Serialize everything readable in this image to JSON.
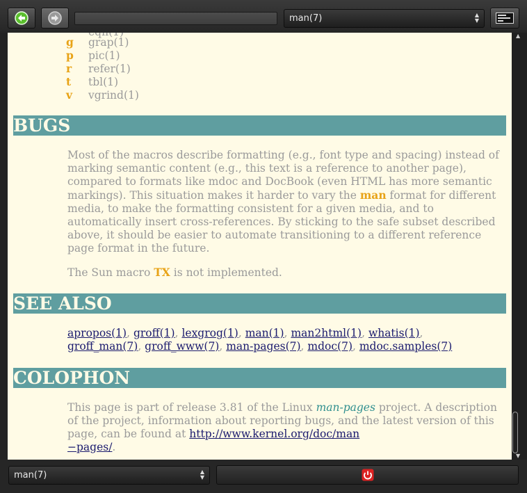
{
  "toolbar": {
    "back_icon": "arrow-left-icon",
    "forward_icon": "arrow-right-icon",
    "page_select": "man(7)",
    "terminal_icon": "terminal-icon"
  },
  "index_entries": [
    {
      "letter": "g",
      "ref": "grap(1)"
    },
    {
      "letter": "p",
      "ref": "pic(1)"
    },
    {
      "letter": "r",
      "ref": "refer(1)"
    },
    {
      "letter": "t",
      "ref": "tbl(1)"
    },
    {
      "letter": "v",
      "ref": "vgrind(1)"
    }
  ],
  "bugs": {
    "title": "BUGS",
    "p1_a": "Most of the macros describe formatting (e.g., font type and spacing) instead of marking semantic content (e.g., this text is a reference to another page), compared to formats like mdoc and DocBook (even HTML has more semantic markings). This situation makes it harder to vary the",
    "p1_hl": "man",
    "p1_b": "format for different media, to make the formatting consistent for a given media, and to automatically insert cross-references. By sticking to the safe subset described above, it should be easier to automate transitioning to a different reference page format in the future.",
    "p2_a": "The Sun macro",
    "p2_hl": "TX",
    "p2_b": "is not implemented."
  },
  "see_also": {
    "title": "SEE ALSO",
    "links": [
      "apropos(1)",
      "groff(1)",
      "lexgrog(1)",
      "man(1)",
      "man2html(1)",
      "whatis(1)",
      "groff_man(7)",
      "groff_www(7)",
      "man-pages(7)",
      "mdoc(7)",
      "mdoc.samples(7)"
    ]
  },
  "colophon": {
    "title": "COLOPHON",
    "text_a": "This page is part of release 3.81 of the Linux",
    "project": "man-pages",
    "text_b": "project. A description of the project, information about reporting bugs, and the latest version of this page, can be found at",
    "url_1": "http://www.kernel.org/doc/man",
    "url_2": "−pages/",
    "end": "."
  },
  "bottom": {
    "page_select": "man(7)",
    "quit_icon": "power-icon"
  }
}
